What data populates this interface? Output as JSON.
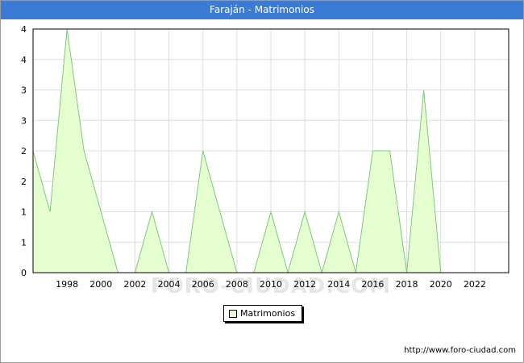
{
  "title": "Faraján - Matrimonios",
  "source_url": "http://www.foro-ciudad.com",
  "watermark": "FORO-CIUDAD.COM",
  "colors": {
    "title_bg": "#3a7bd5",
    "fill": "#e6ffd0",
    "line": "#7fc77f",
    "grid": "#dddddd"
  },
  "chart_data": {
    "type": "area",
    "title": "Faraján - Matrimonios",
    "xlabel": "",
    "ylabel": "",
    "x": [
      1996,
      1997,
      1998,
      1999,
      2000,
      2001,
      2002,
      2003,
      2004,
      2005,
      2006,
      2007,
      2008,
      2009,
      2010,
      2011,
      2012,
      2013,
      2014,
      2015,
      2016,
      2017,
      2018,
      2019,
      2020
    ],
    "series": [
      {
        "name": "Matrimonios",
        "values": [
          2,
          1,
          4,
          2,
          1,
          0,
          0,
          1,
          0,
          0,
          2,
          1,
          0,
          0,
          1,
          0,
          1,
          0,
          1,
          0,
          2,
          2,
          0,
          3,
          0
        ]
      }
    ],
    "xlim": [
      1996,
      2024
    ],
    "ylim": [
      0,
      4
    ],
    "x_tick_labels": [
      "1998",
      "2000",
      "2002",
      "2004",
      "2006",
      "2008",
      "2010",
      "2012",
      "2014",
      "2016",
      "2018",
      "2020",
      "2022"
    ],
    "y_tick_labels": [
      "0",
      "1",
      "1",
      "2",
      "2",
      "3",
      "3",
      "4",
      "4"
    ],
    "grid": true,
    "legend_position": "bottom-center"
  }
}
